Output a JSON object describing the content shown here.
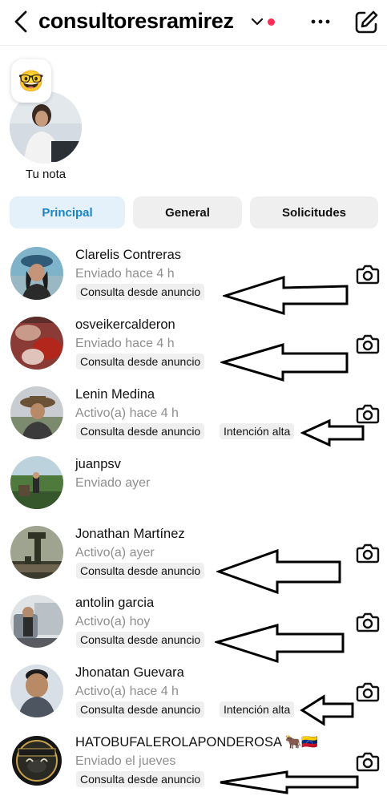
{
  "header": {
    "title": "consultoresramirez",
    "back_icon": "chevron-left-icon",
    "more_icon": "more-horizontal-icon",
    "compose_icon": "compose-icon",
    "status_dot_color": "#ff2d55"
  },
  "note": {
    "emoji": "🤓",
    "label": "Tu nota"
  },
  "tabs": [
    {
      "label": "Principal",
      "active": true
    },
    {
      "label": "General",
      "active": false
    },
    {
      "label": "Solicitudes",
      "active": false
    }
  ],
  "accent_color": "#1a84c7",
  "conversations": [
    {
      "name": "Clarelis Contreras",
      "status": "Enviado hace 4 h",
      "tags": [
        "Consulta desde anuncio"
      ],
      "camera": true
    },
    {
      "name": "osveikercalderon",
      "status": "Enviado hace 4 h",
      "tags": [
        "Consulta desde anuncio"
      ],
      "camera": true
    },
    {
      "name": "Lenin Medina",
      "status": "Activo(a) hace 4 h",
      "tags": [
        "Consulta desde anuncio",
        "Intención alta"
      ],
      "camera": true
    },
    {
      "name": "juanpsv",
      "status": "Enviado ayer",
      "tags": [],
      "camera": false
    },
    {
      "name": "Jonathan Martínez",
      "status": "Activo(a) ayer",
      "tags": [
        "Consulta desde anuncio"
      ],
      "camera": true
    },
    {
      "name": "antolin garcia",
      "status": "Activo(a) hoy",
      "tags": [
        "Consulta desde anuncio"
      ],
      "camera": true
    },
    {
      "name": "Jhonatan Guevara",
      "status": "Activo(a) hace 4 h",
      "tags": [
        "Consulta desde anuncio",
        "Intención alta"
      ],
      "camera": true
    },
    {
      "name": "HATOBUFALEROLAPONDEROSA 🐂🇻🇪",
      "status": "Enviado el jueves",
      "tags": [
        "Consulta desde anuncio"
      ],
      "camera": true
    }
  ]
}
